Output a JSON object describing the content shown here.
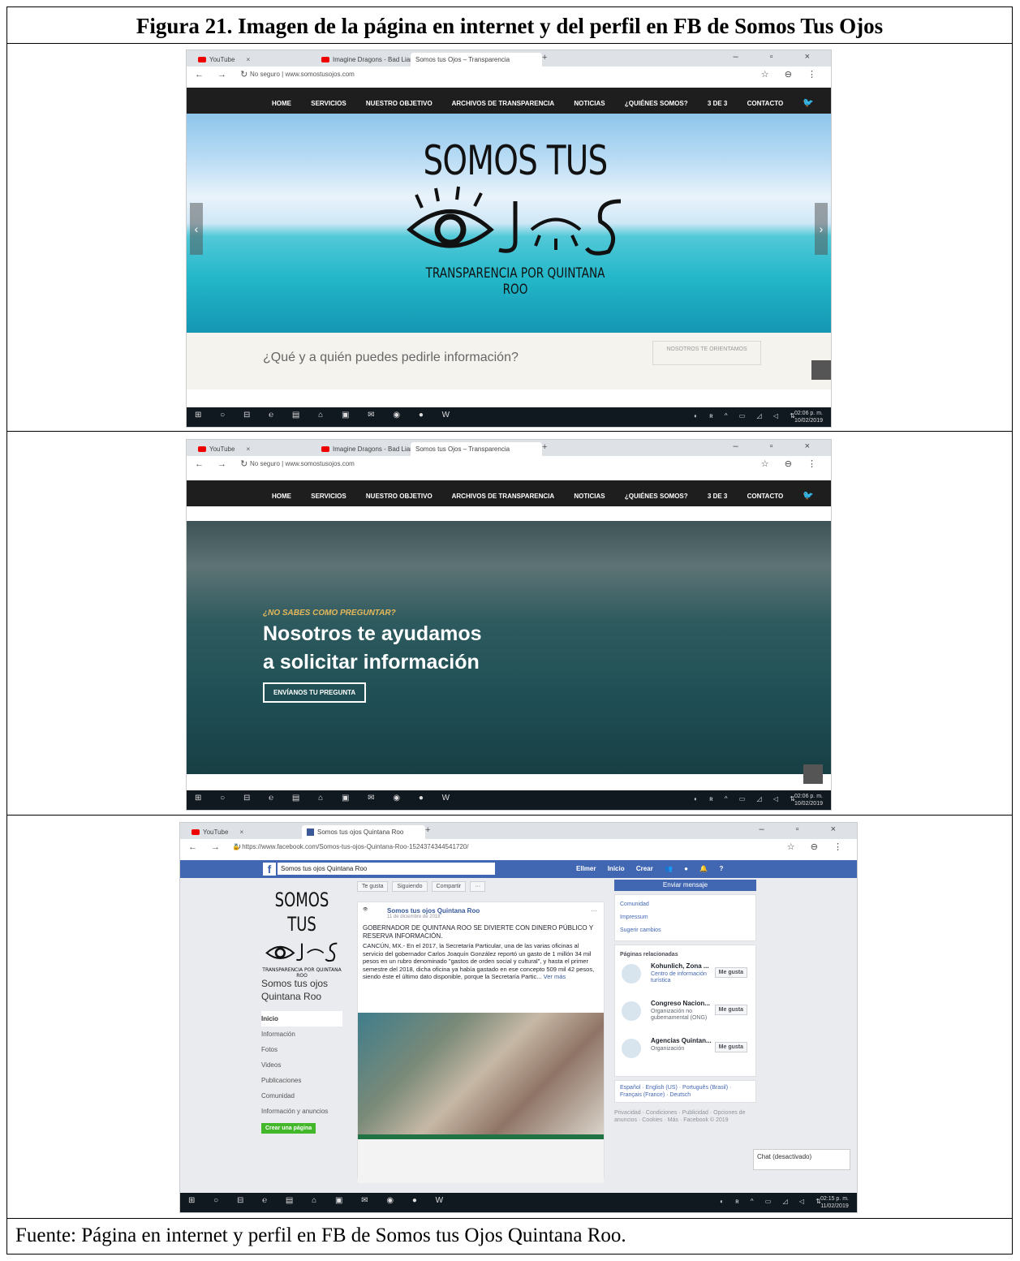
{
  "figure": {
    "title": "Figura 21. Imagen de la página en internet y del perfil en FB de Somos Tus Ojos",
    "source": "Fuente: Página en internet y perfil en FB de Somos tus Ojos Quintana Roo."
  },
  "browser": {
    "tabs": [
      "YouTube",
      "Imagine Dragons - Bad Liar",
      "Somos tus Ojos – Transparencia"
    ],
    "security": "No seguro",
    "url": "www.somostusojos.com"
  },
  "site": {
    "nav": [
      "HOME",
      "SERVICIOS",
      "NUESTRO OBJETIVO",
      "ARCHIVOS DE TRANSPARENCIA",
      "NOTICIAS",
      "¿QUIÉNES SOMOS?",
      "3 DE 3",
      "CONTACTO"
    ],
    "logo_line1": "SOMOS TUS",
    "logo_line2": "TRANSPARENCIA POR QUINTANA ROO",
    "question": "¿Qué y a quién puedes pedirle información?",
    "orient_button": "NOSOTROS TE ORIENTAMOS",
    "hero2_kicker": "¿NO SABES COMO PREGUNTAR?",
    "hero2_line1": "Nosotros te ayudamos",
    "hero2_line2": "a solicitar información",
    "hero2_button": "ENVÍANOS TU PREGUNTA"
  },
  "taskbar": {
    "time1": "02:06 p. m.",
    "date1": "10/02/2019",
    "time3": "02:15 p. m.",
    "date3": "11/02/2019"
  },
  "fb": {
    "tab_title": "Somos tus ojos Quintana Roo",
    "url": "https://www.facebook.com/Somos-tus-ojos-Quintana-Roo-1524374344541720/",
    "search": "Somos tus ojos Quintana Roo",
    "top_right": [
      "Ellmer",
      "Inicio",
      "Crear"
    ],
    "page_name": "Somos tus ojos Quintana Roo",
    "menu": [
      "Inicio",
      "Información",
      "Fotos",
      "Videos",
      "Publicaciones",
      "Comunidad",
      "Información y anuncios"
    ],
    "create_page": "Crear una página",
    "actions": [
      "Te gusta",
      "Siguiendo",
      "Compartir",
      "···"
    ],
    "post_name": "Somos tus ojos Quintana Roo",
    "post_date": "11 de diciembre de 2018 ·",
    "post_title": "GOBERNADOR DE QUINTANA ROO SE DIVIERTE CON DINERO PÚBLICO Y RESERVA INFORMACIÓN.",
    "post_text": "CANCÚN, MX.- En el 2017, la Secretaría Particular, una de las varias oficinas al servicio del gobernador Carlos Joaquín González reportó un gasto de 1 millón 34 mil pesos en un rubro denominado \"gastos de orden social y cultural\", y hasta el primer semestre del 2018, dicha oficina ya había gastado en ese concepto 509 mil 42 pesos, siendo éste el último dato disponible, porque la Secretaría Partic...",
    "see_more": "Ver más",
    "send_message": "Enviar mensaje",
    "info_rows": [
      "Comunidad",
      "Impressum",
      "Sugerir cambios"
    ],
    "related_heading": "Páginas relacionadas",
    "related": [
      {
        "name": "Kohunlich, Zona ...",
        "category": "Centro de información turística"
      },
      {
        "name": "Congreso Nacion...",
        "category": "Organización no gubernamental (ONG)"
      },
      {
        "name": "Agencias Quintan...",
        "category": "Organización"
      }
    ],
    "like_label": "Me gusta",
    "languages": "Español · English (US) · Português (Brasil) · Français (France) · Deutsch",
    "footer": "Privacidad · Condiciones · Publicidad · Opciones de anuncios · Cookies · Más · Facebook © 2019",
    "chat": "Chat (desactivado)"
  }
}
